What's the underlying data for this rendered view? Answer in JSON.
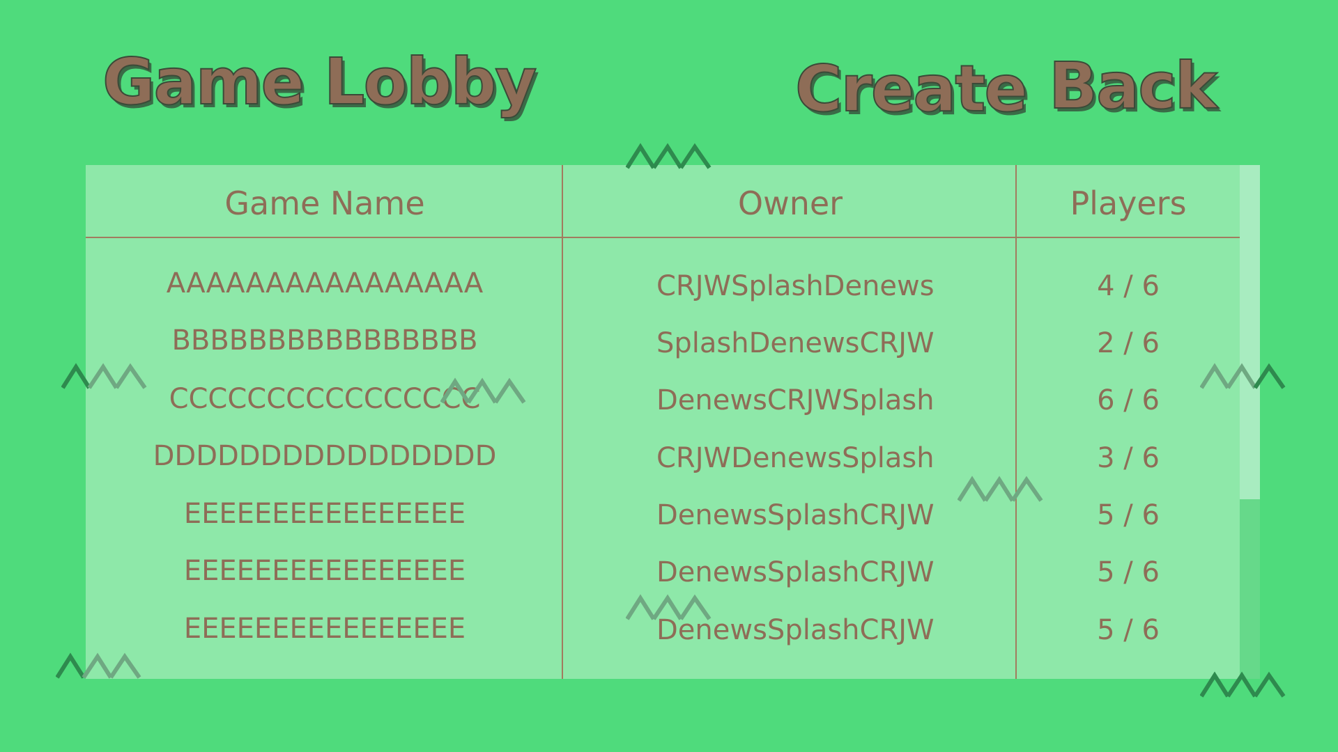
{
  "header": {
    "title": "Game Lobby",
    "create_label": "Create",
    "back_label": "Back"
  },
  "table": {
    "columns": [
      "Game Name",
      "Owner",
      "Players"
    ],
    "rows": [
      {
        "name": "AAAAAAAAAAAAAAAA",
        "owner": "CRJWSplashDenews",
        "players": "4 / 6"
      },
      {
        "name": "BBBBBBBBBBBBBBBB",
        "owner": "SplashDenewsCRJW",
        "players": "2 / 6"
      },
      {
        "name": "CCCCCCCCCCCCCCCC",
        "owner": "DenewsCRJWSplash",
        "players": "6 / 6"
      },
      {
        "name": "DDDDDDDDDDDDDDDD",
        "owner": "CRJWDenewsSplash",
        "players": "3 / 6"
      },
      {
        "name": "EEEEEEEEEEEEEEEE",
        "owner": "DenewsSplashCRJW",
        "players": "5 / 6"
      },
      {
        "name": "EEEEEEEEEEEEEEEE",
        "owner": "DenewsSplashCRJW",
        "players": "5 / 6"
      },
      {
        "name": "EEEEEEEEEEEEEEEE",
        "owner": "DenewsSplashCRJW",
        "players": "5 / 6"
      }
    ]
  },
  "colors": {
    "background": "#4fdb7c",
    "table_background": "#8ee8a9",
    "text": "#8e6d57",
    "lines": "#a27b5e",
    "zigzag_dark": "#2e8a4e",
    "zigzag_light": "#6fa882"
  }
}
